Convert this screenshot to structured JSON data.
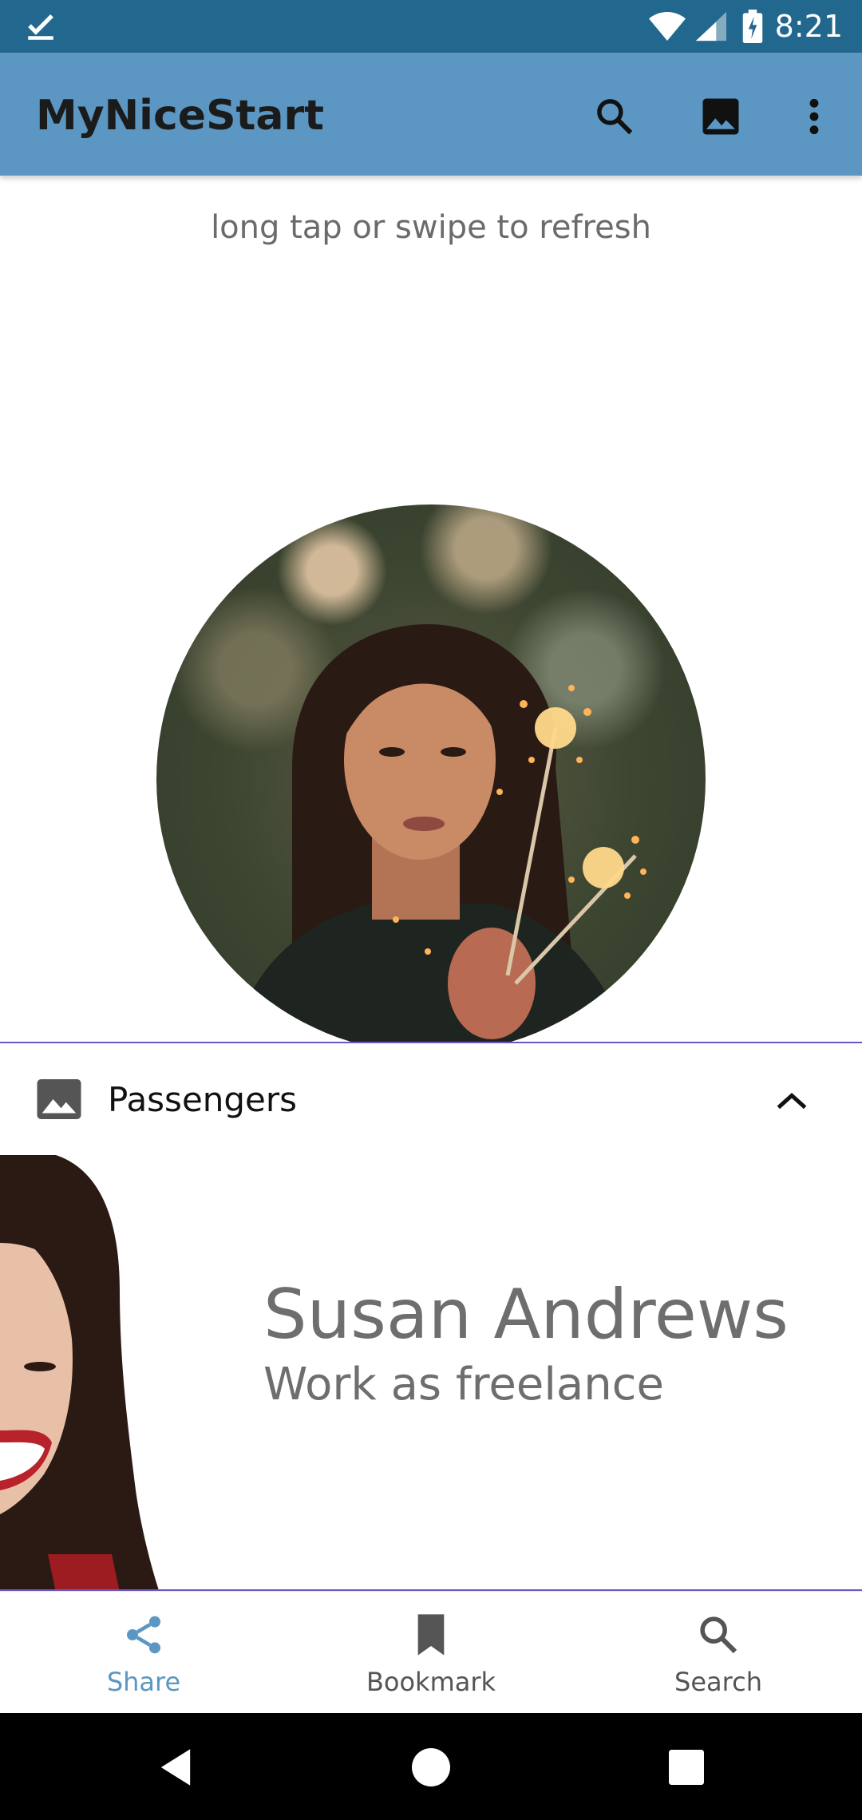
{
  "status_bar": {
    "time": "8:21",
    "icons": [
      "download-done-icon",
      "wifi-icon",
      "signal-icon",
      "battery-charging-icon"
    ]
  },
  "app_bar": {
    "title": "MyNiceStart",
    "actions": [
      "search-icon",
      "image-icon",
      "more-vert-icon"
    ],
    "color": "#5b97c2"
  },
  "hint": {
    "text": "long tap or swipe to refresh"
  },
  "panel": {
    "title": "Passengers",
    "icon": "image-icon",
    "toggle_icon": "chevron-up-icon",
    "passenger": {
      "name": "Susan Andrews",
      "role": "Work as freelance"
    }
  },
  "bottom_nav": {
    "items": [
      {
        "label": "Share",
        "icon": "share-icon",
        "active": true
      },
      {
        "label": "Bookmark",
        "icon": "bookmark-icon",
        "active": false
      },
      {
        "label": "Search",
        "icon": "search-icon",
        "active": false
      }
    ],
    "active_color": "#5b97c2"
  },
  "system_nav": {
    "buttons": [
      "back-icon",
      "home-icon",
      "recents-icon"
    ]
  }
}
